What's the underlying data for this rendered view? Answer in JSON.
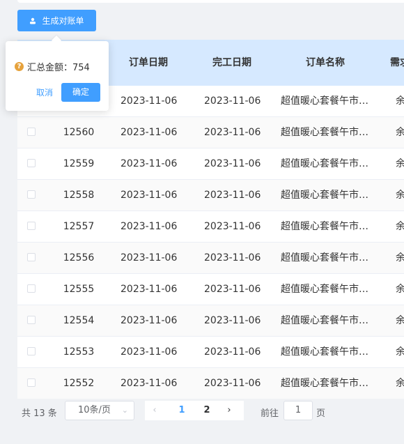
{
  "toolbar": {
    "generate_label": "生成对账单"
  },
  "table": {
    "columns": {
      "order_date": "订单日期",
      "complete_date": "完工日期",
      "order_name": "订单名称",
      "requirement": "需求"
    },
    "rows": [
      {
        "id": "",
        "order_date": "2023-11-06",
        "complete_date": "2023-11-06",
        "name": "超值暖心套餐午市…",
        "req": "余"
      },
      {
        "id": "12560",
        "order_date": "2023-11-06",
        "complete_date": "2023-11-06",
        "name": "超值暖心套餐午市…",
        "req": "余"
      },
      {
        "id": "12559",
        "order_date": "2023-11-06",
        "complete_date": "2023-11-06",
        "name": "超值暖心套餐午市…",
        "req": "余"
      },
      {
        "id": "12558",
        "order_date": "2023-11-06",
        "complete_date": "2023-11-06",
        "name": "超值暖心套餐午市…",
        "req": "余"
      },
      {
        "id": "12557",
        "order_date": "2023-11-06",
        "complete_date": "2023-11-06",
        "name": "超值暖心套餐午市…",
        "req": "余"
      },
      {
        "id": "12556",
        "order_date": "2023-11-06",
        "complete_date": "2023-11-06",
        "name": "超值暖心套餐午市…",
        "req": "余"
      },
      {
        "id": "12555",
        "order_date": "2023-11-06",
        "complete_date": "2023-11-06",
        "name": "超值暖心套餐午市…",
        "req": "余"
      },
      {
        "id": "12554",
        "order_date": "2023-11-06",
        "complete_date": "2023-11-06",
        "name": "超值暖心套餐午市…",
        "req": "余"
      },
      {
        "id": "12553",
        "order_date": "2023-11-06",
        "complete_date": "2023-11-06",
        "name": "超值暖心套餐午市…",
        "req": "余"
      },
      {
        "id": "12552",
        "order_date": "2023-11-06",
        "complete_date": "2023-11-06",
        "name": "超值暖心套餐午市…",
        "req": "余"
      }
    ]
  },
  "popover": {
    "message": "汇总金额：754",
    "cancel_label": "取消",
    "confirm_label": "确定"
  },
  "pagination": {
    "total": "共 13 条",
    "page_size": "10条/页",
    "pages": [
      "1",
      "2"
    ],
    "goto_label": "前往",
    "goto_value": "1",
    "goto_suffix": "页"
  },
  "colors": {
    "primary": "#409eff",
    "header_bg": "#d6e9ff",
    "warning": "#e6a23c"
  }
}
